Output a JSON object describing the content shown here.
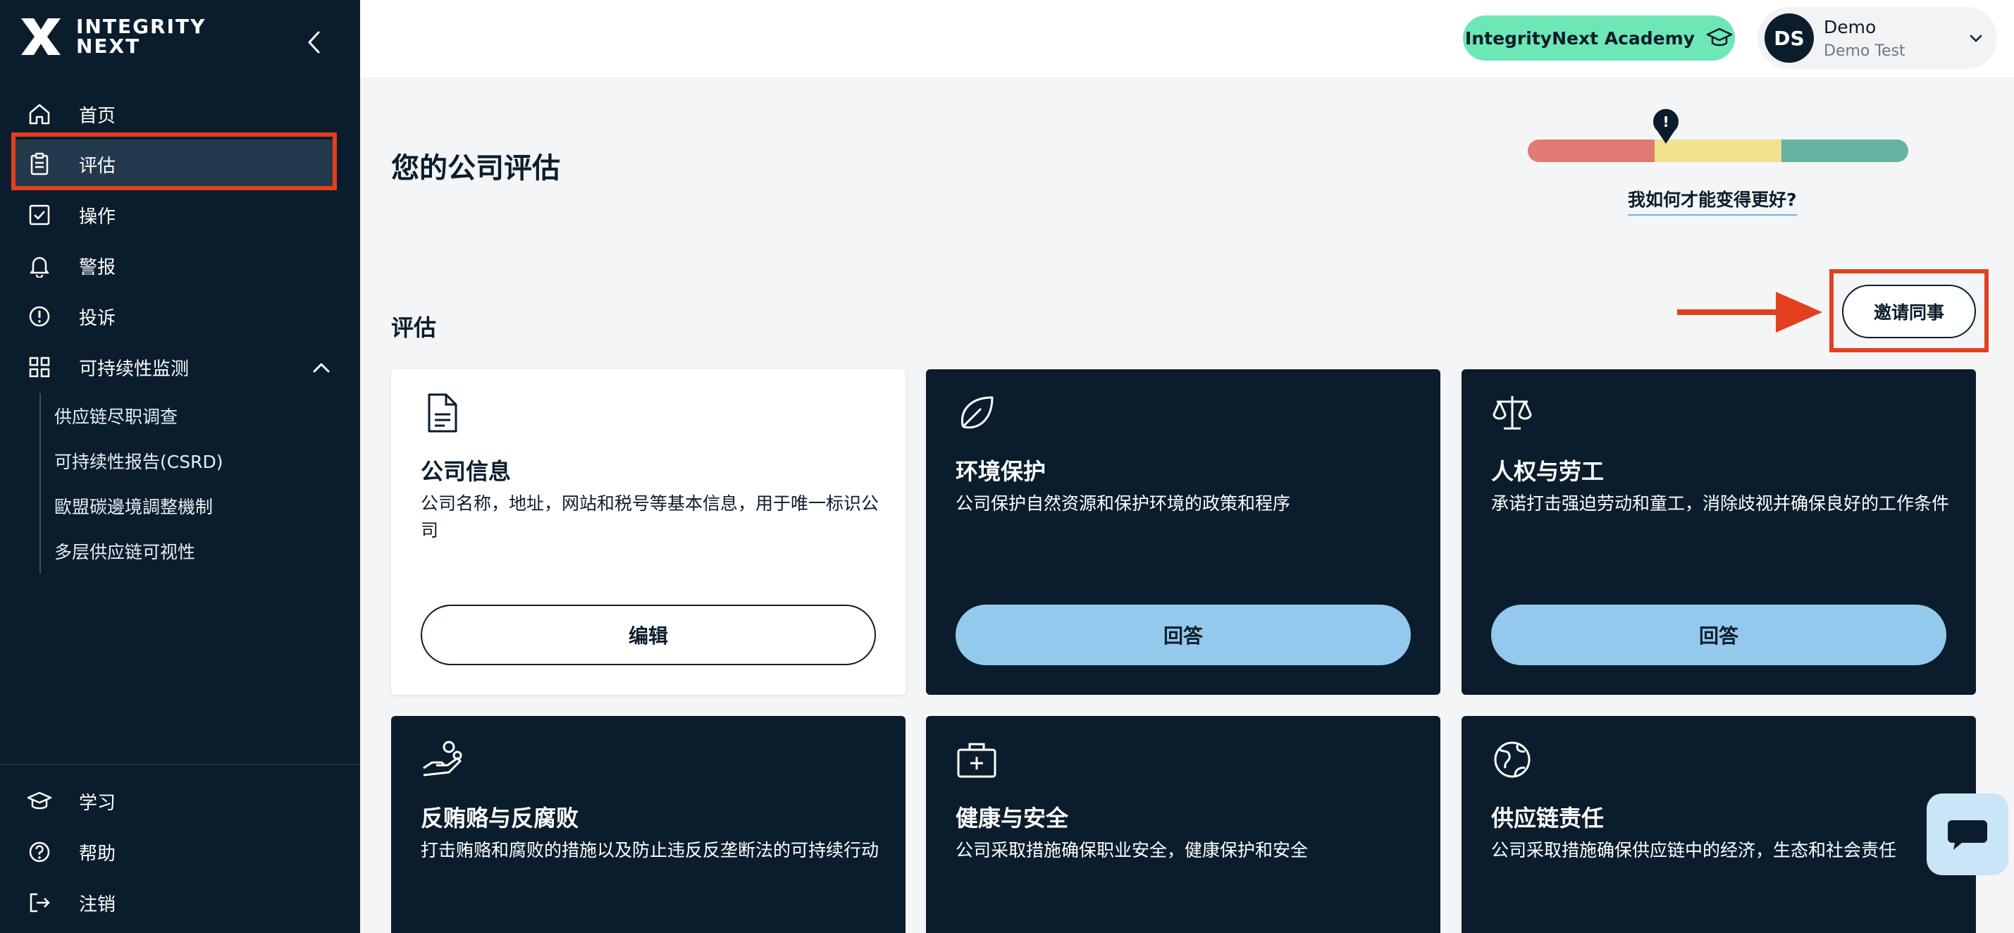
{
  "brand": {
    "logo_line1": "INTEGRITY",
    "logo_line2": "NEXT"
  },
  "sidebar": {
    "items": [
      {
        "label": "首页",
        "icon": "home-icon"
      },
      {
        "label": "评估",
        "icon": "clipboard-icon"
      },
      {
        "label": "操作",
        "icon": "checkbox-icon"
      },
      {
        "label": "警报",
        "icon": "bell-icon"
      },
      {
        "label": "投诉",
        "icon": "alert-circle-icon"
      },
      {
        "label": "可持续性监测",
        "icon": "grid-icon"
      }
    ],
    "sub_items": [
      {
        "label": "供应链尽职调查"
      },
      {
        "label": "可持续性报告(CSRD)"
      },
      {
        "label": "歐盟碳邊境調整機制"
      },
      {
        "label": "多层供应链可视性"
      }
    ],
    "bottom_items": [
      {
        "label": "学习",
        "icon": "graduation-cap-icon"
      },
      {
        "label": "帮助",
        "icon": "help-circle-icon"
      },
      {
        "label": "注销",
        "icon": "logout-icon"
      }
    ]
  },
  "header": {
    "academy_label": "IntegrityNext Academy",
    "user": {
      "initials": "DS",
      "name": "Demo",
      "org": "Demo Test"
    }
  },
  "main": {
    "title": "您的公司评估",
    "score": {
      "colors": [
        "#e07a72",
        "#efe38f",
        "#64b3a0"
      ],
      "marker_symbol": "!"
    },
    "improve_link": "我如何才能变得更好?",
    "section_title": "评估",
    "invite_label": "邀请同事",
    "cards": [
      {
        "title": "公司信息",
        "desc": "公司名称，地址，网站和税号等基本信息，用于唯一标识公司",
        "button": "编辑",
        "icon": "document-icon"
      },
      {
        "title": "环境保护",
        "desc": "公司保护自然资源和保护环境的政策和程序",
        "button": "回答",
        "icon": "leaf-icon"
      },
      {
        "title": "人权与劳工",
        "desc": "承诺打击强迫劳动和童工，消除歧视并确保良好的工作条件",
        "button": "回答",
        "icon": "scales-icon"
      },
      {
        "title": "反贿赂与反腐败",
        "desc": "打击贿赂和腐败的措施以及防止违反反垄断法的可持续行动",
        "icon": "hand-coins-icon"
      },
      {
        "title": "健康与安全",
        "desc": "公司采取措施确保职业安全，健康保护和安全",
        "icon": "first-aid-kit-icon"
      },
      {
        "title": "供应链责任",
        "desc": "公司采取措施确保供应链中的经济，生态和社会责任",
        "icon": "globe-icon"
      }
    ]
  },
  "colors": {
    "sidebar_bg": "#0b1d2c",
    "academy_green": "#6ee7b7",
    "answer_blue": "#93c9ec",
    "annotation_red": "#e2401f"
  }
}
